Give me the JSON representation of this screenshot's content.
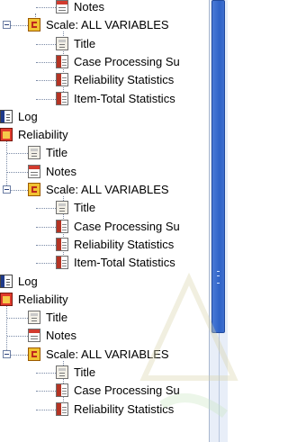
{
  "outline_tree": {
    "rows": [
      {
        "label": "Notes",
        "icon": "notes-icon",
        "level": 3
      },
      {
        "label": "Scale: ALL VARIABLES",
        "icon": "scale-icon",
        "level": 2,
        "expanded": true
      },
      {
        "label": "Title",
        "icon": "title-icon",
        "level": 3
      },
      {
        "label": "Case Processing Su",
        "icon": "table-icon",
        "level": 3
      },
      {
        "label": "Reliability Statistics",
        "icon": "table-icon",
        "level": 3
      },
      {
        "label": "Item-Total Statistics",
        "icon": "table-icon",
        "level": 3
      },
      {
        "label": "Log",
        "icon": "log-icon",
        "level": 0
      },
      {
        "label": "Reliability",
        "icon": "book-icon",
        "level": 0
      },
      {
        "label": "Title",
        "icon": "title-icon",
        "level": 2
      },
      {
        "label": "Notes",
        "icon": "notes-icon",
        "level": 2
      },
      {
        "label": "Scale: ALL VARIABLES",
        "icon": "scale-icon",
        "level": 2,
        "expanded": true
      },
      {
        "label": "Title",
        "icon": "title-icon",
        "level": 3
      },
      {
        "label": "Case Processing Su",
        "icon": "table-icon",
        "level": 3
      },
      {
        "label": "Reliability Statistics",
        "icon": "table-icon",
        "level": 3
      },
      {
        "label": "Item-Total Statistics",
        "icon": "table-icon",
        "level": 3
      },
      {
        "label": "Log",
        "icon": "log-icon",
        "level": 0
      },
      {
        "label": "Reliability",
        "icon": "book-icon",
        "level": 0
      },
      {
        "label": "Title",
        "icon": "title-icon",
        "level": 2
      },
      {
        "label": "Notes",
        "icon": "notes-icon",
        "level": 2
      },
      {
        "label": "Scale: ALL VARIABLES",
        "icon": "scale-icon",
        "level": 2,
        "expanded": true
      },
      {
        "label": "Title",
        "icon": "title-icon",
        "level": 3
      },
      {
        "label": "Case Processing Su",
        "icon": "table-icon",
        "level": 3
      },
      {
        "label": "Reliability Statistics",
        "icon": "table-icon",
        "level": 3
      }
    ]
  },
  "colors": {
    "scrollbar_thumb": "#2f63c8",
    "tree_lines": "#7a8aa6"
  }
}
